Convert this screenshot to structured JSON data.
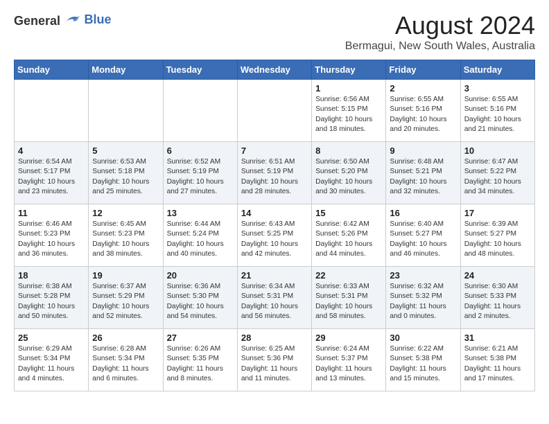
{
  "logo": {
    "general": "General",
    "blue": "Blue"
  },
  "title": "August 2024",
  "location": "Bermagui, New South Wales, Australia",
  "weekdays": [
    "Sunday",
    "Monday",
    "Tuesday",
    "Wednesday",
    "Thursday",
    "Friday",
    "Saturday"
  ],
  "weeks": [
    [
      {
        "day": "",
        "info": ""
      },
      {
        "day": "",
        "info": ""
      },
      {
        "day": "",
        "info": ""
      },
      {
        "day": "",
        "info": ""
      },
      {
        "day": "1",
        "info": "Sunrise: 6:56 AM\nSunset: 5:15 PM\nDaylight: 10 hours\nand 18 minutes."
      },
      {
        "day": "2",
        "info": "Sunrise: 6:55 AM\nSunset: 5:16 PM\nDaylight: 10 hours\nand 20 minutes."
      },
      {
        "day": "3",
        "info": "Sunrise: 6:55 AM\nSunset: 5:16 PM\nDaylight: 10 hours\nand 21 minutes."
      }
    ],
    [
      {
        "day": "4",
        "info": "Sunrise: 6:54 AM\nSunset: 5:17 PM\nDaylight: 10 hours\nand 23 minutes."
      },
      {
        "day": "5",
        "info": "Sunrise: 6:53 AM\nSunset: 5:18 PM\nDaylight: 10 hours\nand 25 minutes."
      },
      {
        "day": "6",
        "info": "Sunrise: 6:52 AM\nSunset: 5:19 PM\nDaylight: 10 hours\nand 27 minutes."
      },
      {
        "day": "7",
        "info": "Sunrise: 6:51 AM\nSunset: 5:19 PM\nDaylight: 10 hours\nand 28 minutes."
      },
      {
        "day": "8",
        "info": "Sunrise: 6:50 AM\nSunset: 5:20 PM\nDaylight: 10 hours\nand 30 minutes."
      },
      {
        "day": "9",
        "info": "Sunrise: 6:48 AM\nSunset: 5:21 PM\nDaylight: 10 hours\nand 32 minutes."
      },
      {
        "day": "10",
        "info": "Sunrise: 6:47 AM\nSunset: 5:22 PM\nDaylight: 10 hours\nand 34 minutes."
      }
    ],
    [
      {
        "day": "11",
        "info": "Sunrise: 6:46 AM\nSunset: 5:23 PM\nDaylight: 10 hours\nand 36 minutes."
      },
      {
        "day": "12",
        "info": "Sunrise: 6:45 AM\nSunset: 5:23 PM\nDaylight: 10 hours\nand 38 minutes."
      },
      {
        "day": "13",
        "info": "Sunrise: 6:44 AM\nSunset: 5:24 PM\nDaylight: 10 hours\nand 40 minutes."
      },
      {
        "day": "14",
        "info": "Sunrise: 6:43 AM\nSunset: 5:25 PM\nDaylight: 10 hours\nand 42 minutes."
      },
      {
        "day": "15",
        "info": "Sunrise: 6:42 AM\nSunset: 5:26 PM\nDaylight: 10 hours\nand 44 minutes."
      },
      {
        "day": "16",
        "info": "Sunrise: 6:40 AM\nSunset: 5:27 PM\nDaylight: 10 hours\nand 46 minutes."
      },
      {
        "day": "17",
        "info": "Sunrise: 6:39 AM\nSunset: 5:27 PM\nDaylight: 10 hours\nand 48 minutes."
      }
    ],
    [
      {
        "day": "18",
        "info": "Sunrise: 6:38 AM\nSunset: 5:28 PM\nDaylight: 10 hours\nand 50 minutes."
      },
      {
        "day": "19",
        "info": "Sunrise: 6:37 AM\nSunset: 5:29 PM\nDaylight: 10 hours\nand 52 minutes."
      },
      {
        "day": "20",
        "info": "Sunrise: 6:36 AM\nSunset: 5:30 PM\nDaylight: 10 hours\nand 54 minutes."
      },
      {
        "day": "21",
        "info": "Sunrise: 6:34 AM\nSunset: 5:31 PM\nDaylight: 10 hours\nand 56 minutes."
      },
      {
        "day": "22",
        "info": "Sunrise: 6:33 AM\nSunset: 5:31 PM\nDaylight: 10 hours\nand 58 minutes."
      },
      {
        "day": "23",
        "info": "Sunrise: 6:32 AM\nSunset: 5:32 PM\nDaylight: 11 hours\nand 0 minutes."
      },
      {
        "day": "24",
        "info": "Sunrise: 6:30 AM\nSunset: 5:33 PM\nDaylight: 11 hours\nand 2 minutes."
      }
    ],
    [
      {
        "day": "25",
        "info": "Sunrise: 6:29 AM\nSunset: 5:34 PM\nDaylight: 11 hours\nand 4 minutes."
      },
      {
        "day": "26",
        "info": "Sunrise: 6:28 AM\nSunset: 5:34 PM\nDaylight: 11 hours\nand 6 minutes."
      },
      {
        "day": "27",
        "info": "Sunrise: 6:26 AM\nSunset: 5:35 PM\nDaylight: 11 hours\nand 8 minutes."
      },
      {
        "day": "28",
        "info": "Sunrise: 6:25 AM\nSunset: 5:36 PM\nDaylight: 11 hours\nand 11 minutes."
      },
      {
        "day": "29",
        "info": "Sunrise: 6:24 AM\nSunset: 5:37 PM\nDaylight: 11 hours\nand 13 minutes."
      },
      {
        "day": "30",
        "info": "Sunrise: 6:22 AM\nSunset: 5:38 PM\nDaylight: 11 hours\nand 15 minutes."
      },
      {
        "day": "31",
        "info": "Sunrise: 6:21 AM\nSunset: 5:38 PM\nDaylight: 11 hours\nand 17 minutes."
      }
    ]
  ]
}
